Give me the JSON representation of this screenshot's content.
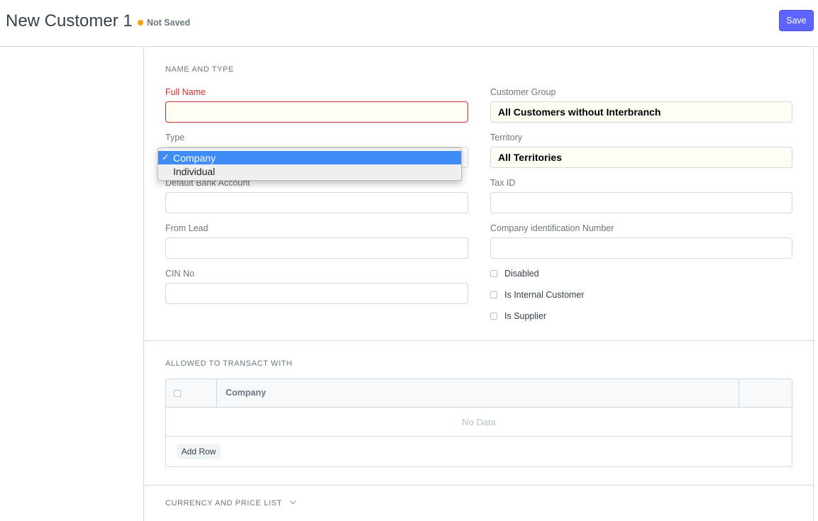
{
  "header": {
    "title": "New Customer 1",
    "status": "Not Saved",
    "save_label": "Save"
  },
  "colors": {
    "primary": "#5e64ff",
    "status_dot": "#ffa00a",
    "error": "#d52c2c",
    "selected_option": "#3f8cf7"
  },
  "section_name_type": {
    "title": "NAME AND TYPE",
    "full_name_label": "Full Name",
    "full_name_value": "",
    "type_label": "Type",
    "default_bank_label": "Default Bank Account",
    "default_bank_value": "",
    "from_lead_label": "From Lead",
    "from_lead_value": "",
    "cin_label": "CIN No",
    "cin_value": "",
    "customer_group_label": "Customer Group",
    "customer_group_value": "All Customers without Interbranch",
    "territory_label": "Territory",
    "territory_value": "All Territories",
    "tax_id_label": "Tax ID",
    "tax_id_value": "",
    "company_id_label": "Company identification Number",
    "company_id_value": "",
    "checks": [
      {
        "label": "Disabled",
        "checked": false
      },
      {
        "label": "Is Internal Customer",
        "checked": false
      },
      {
        "label": "Is Supplier",
        "checked": false
      }
    ]
  },
  "type_dropdown": {
    "options": [
      {
        "label": "Company",
        "selected": true,
        "check": "✓"
      },
      {
        "label": "Individual",
        "selected": false
      }
    ]
  },
  "section_transact": {
    "title": "ALLOWED TO TRANSACT WITH",
    "column_company": "Company",
    "no_data": "No Data",
    "add_row": "Add Row"
  },
  "section_currency": {
    "title": "CURRENCY AND PRICE LIST"
  }
}
